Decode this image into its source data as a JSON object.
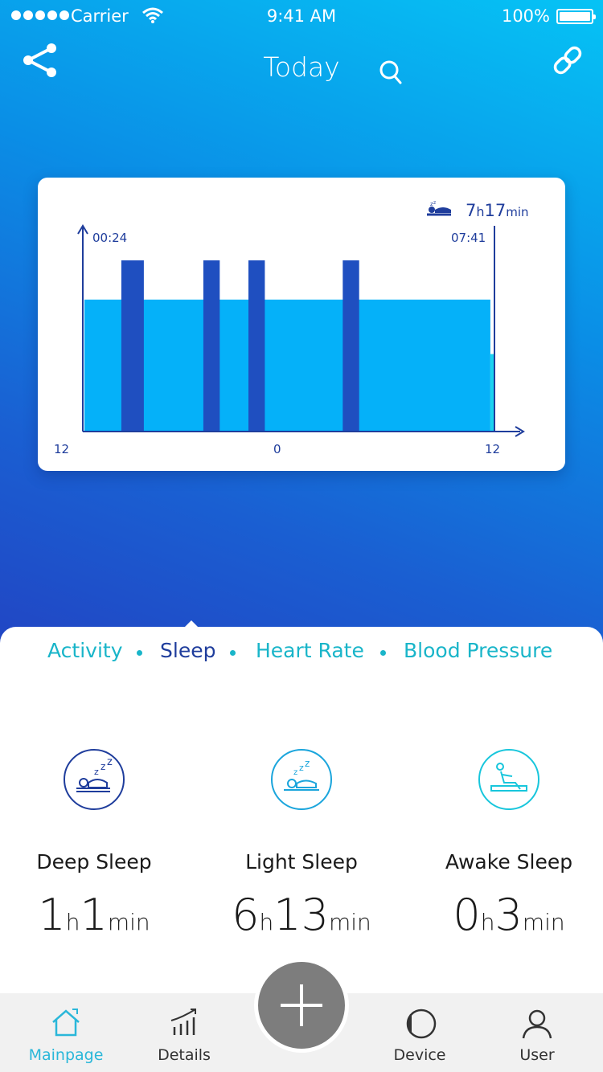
{
  "status_bar": {
    "carrier": "Carrier",
    "time": "9:41 AM",
    "battery": "100%"
  },
  "header": {
    "title": "Today"
  },
  "sleep_chart": {
    "total_hours": "7",
    "total_h_unit": "h",
    "total_minutes": "17",
    "total_min_unit": "min",
    "start_time": "00:24",
    "end_time": "07:41",
    "x_tick_left": "12",
    "x_tick_mid": "0",
    "x_tick_right": "12"
  },
  "chart_data": {
    "type": "bar",
    "title": "",
    "series": [
      {
        "name": "",
        "color": "#05b1f9",
        "segments": [
          {
            "start": 0.0,
            "end": 0.99,
            "level": 0.77
          }
        ]
      },
      {
        "name": "",
        "color": "#1f4fc0",
        "segments": [
          {
            "start": 0.09,
            "end": 0.145
          },
          {
            "start": 0.29,
            "end": 0.33
          },
          {
            "start": 0.4,
            "end": 0.44
          },
          {
            "start": 0.63,
            "end": 0.67
          }
        ]
      },
      {
        "name": "",
        "color": "#1ad3f0",
        "segments": [
          {
            "start": 0.99,
            "end": 1.0,
            "level": 0.45
          }
        ]
      }
    ],
    "grid": false
  },
  "category_tabs": [
    {
      "label": "Activity",
      "active": false
    },
    {
      "label": "Sleep",
      "active": true
    },
    {
      "label": "Heart Rate",
      "active": false
    },
    {
      "label": "Blood Pressure",
      "active": false
    }
  ],
  "stats": [
    {
      "label": "Deep Sleep",
      "hours": "1",
      "minutes": "1",
      "h_unit": "h",
      "min_unit": "min",
      "icon": "deep-sleep-icon",
      "color": "#1f3d9c"
    },
    {
      "label": "Light Sleep",
      "hours": "6",
      "minutes": "13",
      "h_unit": "h",
      "min_unit": "min",
      "icon": "light-sleep-icon",
      "color": "#1aa5dc"
    },
    {
      "label": "Awake Sleep",
      "hours": "0",
      "minutes": "3",
      "h_unit": "h",
      "min_unit": "min",
      "icon": "awake-icon",
      "color": "#18c6dc"
    }
  ],
  "tab_bar": [
    {
      "label": "Mainpage",
      "icon": "home-icon",
      "active": true
    },
    {
      "label": "Details",
      "icon": "chart-icon",
      "active": false
    },
    {
      "label": "Device",
      "icon": "watch-icon",
      "active": false
    },
    {
      "label": "User",
      "icon": "user-icon",
      "active": false
    }
  ],
  "colors": {
    "accent": "#19b5c9",
    "active_tab": "#1f3d9c",
    "light_sleep": "#05b1f9",
    "deep_sleep": "#1f4fc0",
    "awake": "#1ad3f0"
  }
}
